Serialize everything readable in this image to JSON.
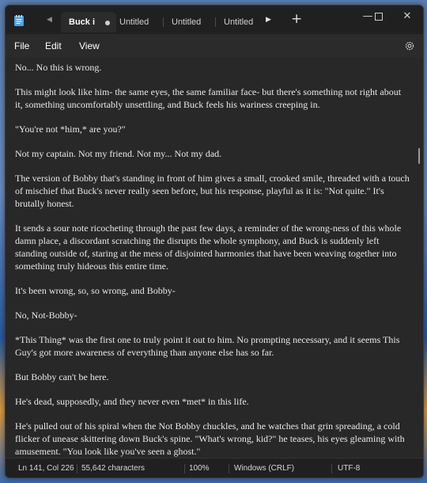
{
  "tabs": [
    {
      "label": "Buck i",
      "active": true,
      "unsaved": true
    },
    {
      "label": "Untitled",
      "active": false
    },
    {
      "label": "Untitled",
      "active": false
    },
    {
      "label": "Untitled",
      "active": false
    }
  ],
  "icons": {
    "app": "notepad-icon",
    "tab_scroll_left": "chevron-left-icon",
    "tab_scroll_right": "chevron-right-icon",
    "new_tab": "plus-icon",
    "minimize": "minimize-icon",
    "maximize": "maximize-icon",
    "close": "close-icon",
    "settings": "gear-icon"
  },
  "menu": {
    "file": "File",
    "edit": "Edit",
    "view": "View"
  },
  "document": {
    "paragraphs": [
      "No... No this is wrong.",
      "This might look like him- the same eyes, the same familiar face- but there's something not right about it, something uncomfortably unsettling, and Buck feels his wariness creeping in.",
      "\"You're not *him,* are you?\"",
      "Not my captain. Not my friend. Not my... Not my dad.",
      "The version of Bobby that's standing in front of him gives a small, crooked smile, threaded with a touch of mischief that Buck's never really seen before, but his response, playful as it is: \"Not quite.\" It's brutally honest.",
      "It sends a sour note ricocheting through the past few days, a reminder of the wrong-ness of this whole damn place, a discordant scratching the disrupts the whole symphony, and Buck is suddenly left standing outside of, staring at the mess of disjointed harmonies that have been weaving together into something truly hideous this entire time.",
      "It's been wrong, so, so wrong, and Bobby-",
      "No, Not-Bobby-",
      "*This Thing* was the first one to truly point it out to him. No prompting necessary, and it seems This Guy's got more awareness of everything than anyone else has so far.",
      "But Bobby can't be here.",
      "He's dead, supposedly, and they never even *met*  in this life.",
      "He's pulled out of his spiral when the Not Bobby chuckles, and he watches that grin spreading, a cold flicker of unease skittering down Buck's spine. \"What's wrong, kid?\" he teases, his eyes gleaming with amusement. \"You look like you've seen a ghost.\""
    ]
  },
  "status": {
    "position": "Ln 141, Col 226",
    "characters": "55,642 characters",
    "zoom": "100%",
    "line_ending": "Windows (CRLF)",
    "encoding": "UTF-8"
  }
}
